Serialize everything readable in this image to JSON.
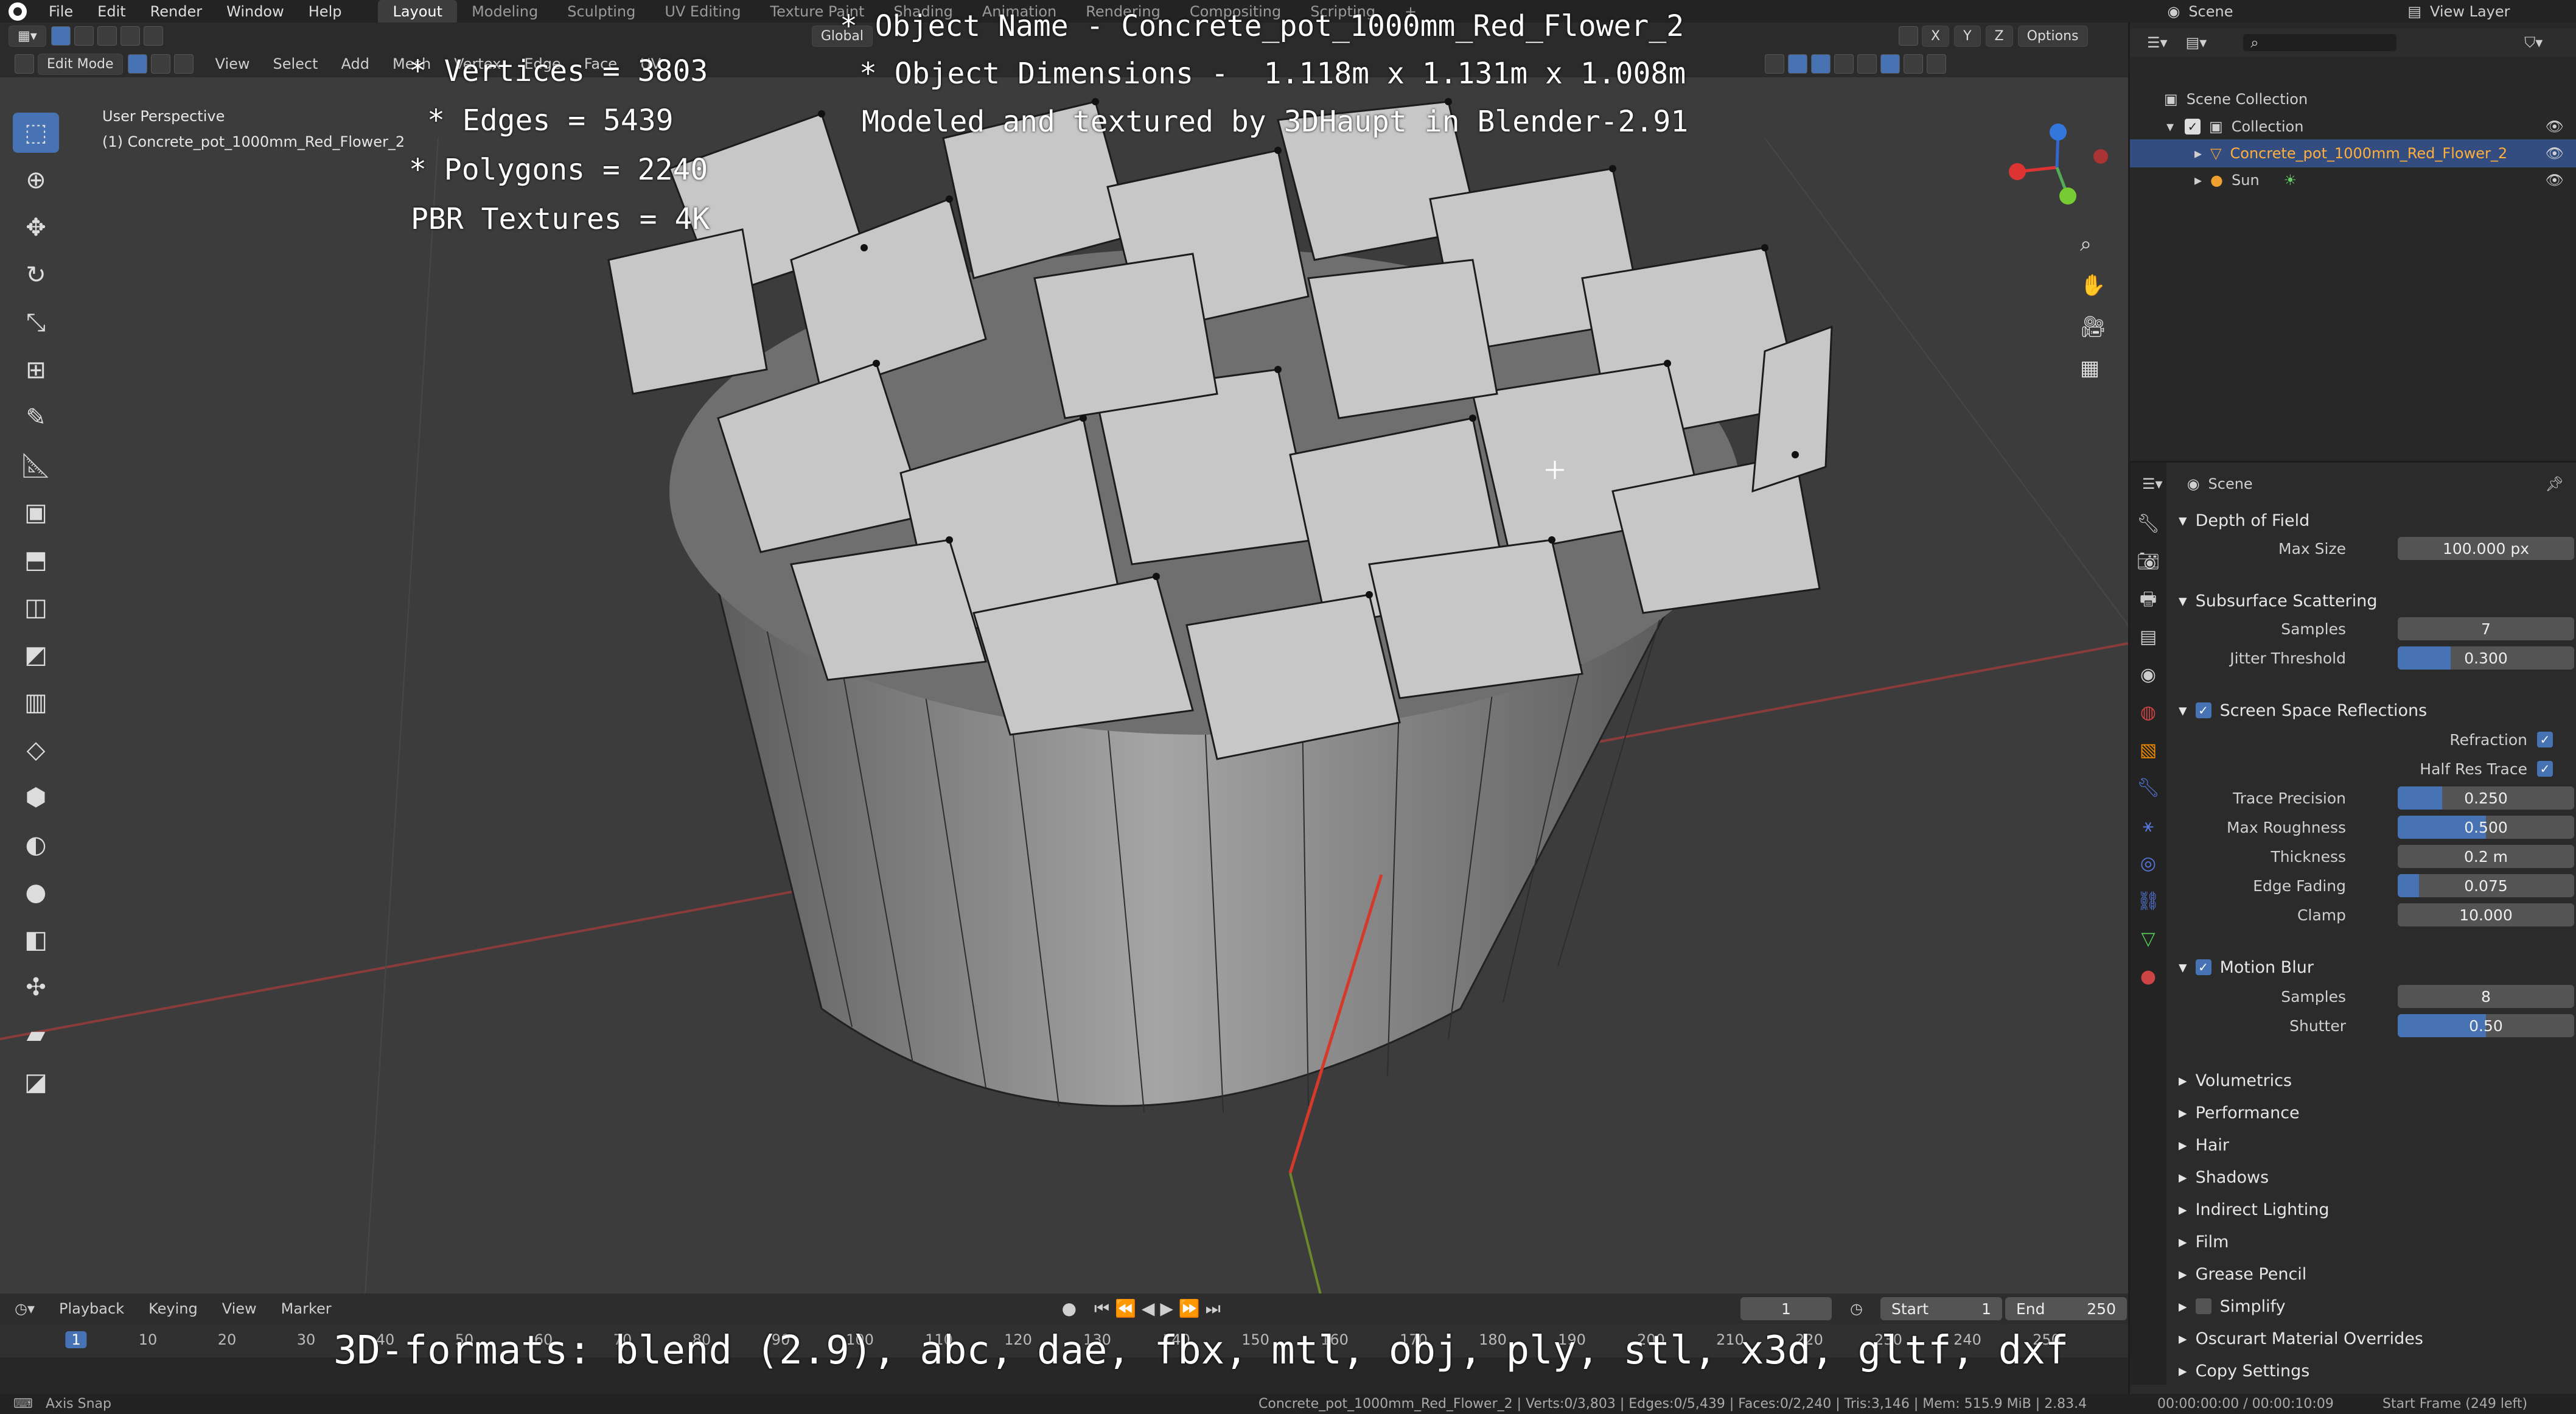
{
  "menubar": {
    "menus": [
      "File",
      "Edit",
      "Render",
      "Window",
      "Help"
    ],
    "workspaces": [
      "Layout",
      "Modeling",
      "Sculpting",
      "UV Editing",
      "Texture Paint",
      "Shading",
      "Animation",
      "Rendering",
      "Compositing",
      "Scripting"
    ],
    "active_workspace": "Layout",
    "scene": "Scene",
    "view_layer": "View Layer"
  },
  "viewport_header": {
    "mode": "Edit Mode",
    "menus": [
      "View",
      "Select",
      "Add",
      "Mesh",
      "Vertex",
      "Edge",
      "Face",
      "UV"
    ],
    "orientation": "Global",
    "axes": [
      "X",
      "Y",
      "Z"
    ],
    "options": "Options"
  },
  "viewport": {
    "perspective": "User Perspective",
    "object_label": "(1) Concrete_pot_1000mm_Red_Flower_2"
  },
  "overlay": {
    "object_name": "* Object Name - Concrete_pot_1000mm_Red_Flower_2",
    "dimensions": "* Object Dimensions -  1.118m x 1.131m x 1.008m",
    "modeled_by": "Modeled and textured by 3DHaupt in Blender-2.91",
    "vertices": "* Vertices = 3803",
    "edges": "* Edges = 5439",
    "polygons": "* Polygons = 2240",
    "textures": "PBR Textures = 4K",
    "formats": "3D-formats: blend (2.9), abc, dae, fbx, mtl, obj, ply, stl, x3d, gltf, dxf"
  },
  "outliner": {
    "root": "Scene Collection",
    "collection": "Collection",
    "items": [
      "Concrete_pot_1000mm_Red_Flower_2",
      "Sun"
    ]
  },
  "properties": {
    "context": "Scene",
    "depth_of_field": {
      "title": "Depth of Field",
      "max_size_label": "Max Size",
      "max_size": "100.000 px"
    },
    "sss": {
      "title": "Subsurface Scattering",
      "samples_label": "Samples",
      "samples": "7",
      "jitter_label": "Jitter Threshold",
      "jitter": "0.300",
      "jitter_frac": 0.3
    },
    "ssr": {
      "title": "Screen Space Reflections",
      "refraction_label": "Refraction",
      "half_res_label": "Half Res Trace",
      "trace_label": "Trace Precision",
      "trace": "0.250",
      "trace_frac": 0.25,
      "rough_label": "Max Roughness",
      "rough": "0.500",
      "rough_frac": 0.5,
      "thick_label": "Thickness",
      "thick": "0.2 m",
      "fade_label": "Edge Fading",
      "fade": "0.075",
      "fade_frac": 0.12,
      "clamp_label": "Clamp",
      "clamp": "10.000"
    },
    "motion_blur": {
      "title": "Motion Blur",
      "samples_label": "Samples",
      "samples": "8",
      "shutter_label": "Shutter",
      "shutter": "0.50",
      "shutter_frac": 0.5
    },
    "collapsed": [
      "Volumetrics",
      "Performance",
      "Hair",
      "Shadows",
      "Indirect Lighting",
      "Film",
      "Grease Pencil",
      "Simplify",
      "Oscurart Material Overrides",
      "Copy Settings"
    ]
  },
  "timeline": {
    "menus": [
      "Playback",
      "Keying",
      "View",
      "Marker"
    ],
    "current_frame": "1",
    "start_label": "Start",
    "start": "1",
    "end_label": "End",
    "end": "250",
    "ticks": [
      "1",
      "10",
      "20",
      "30",
      "40",
      "50",
      "60",
      "70",
      "80",
      "90",
      "100",
      "110",
      "120",
      "130",
      "140",
      "150",
      "160",
      "170",
      "180",
      "190",
      "200",
      "210",
      "220",
      "230",
      "240",
      "250"
    ]
  },
  "statusbar": {
    "left": "Axis Snap",
    "center": "Concrete_pot_1000mm_Red_Flower_2 | Verts:0/3,803 | Edges:0/5,439 | Faces:0/2,240 | Tris:3,146 | Mem: 515.9 MiB | 2.83.4",
    "time": "00:00:00:00 / 00:00:10:09",
    "right": "Start Frame (249 left)"
  }
}
